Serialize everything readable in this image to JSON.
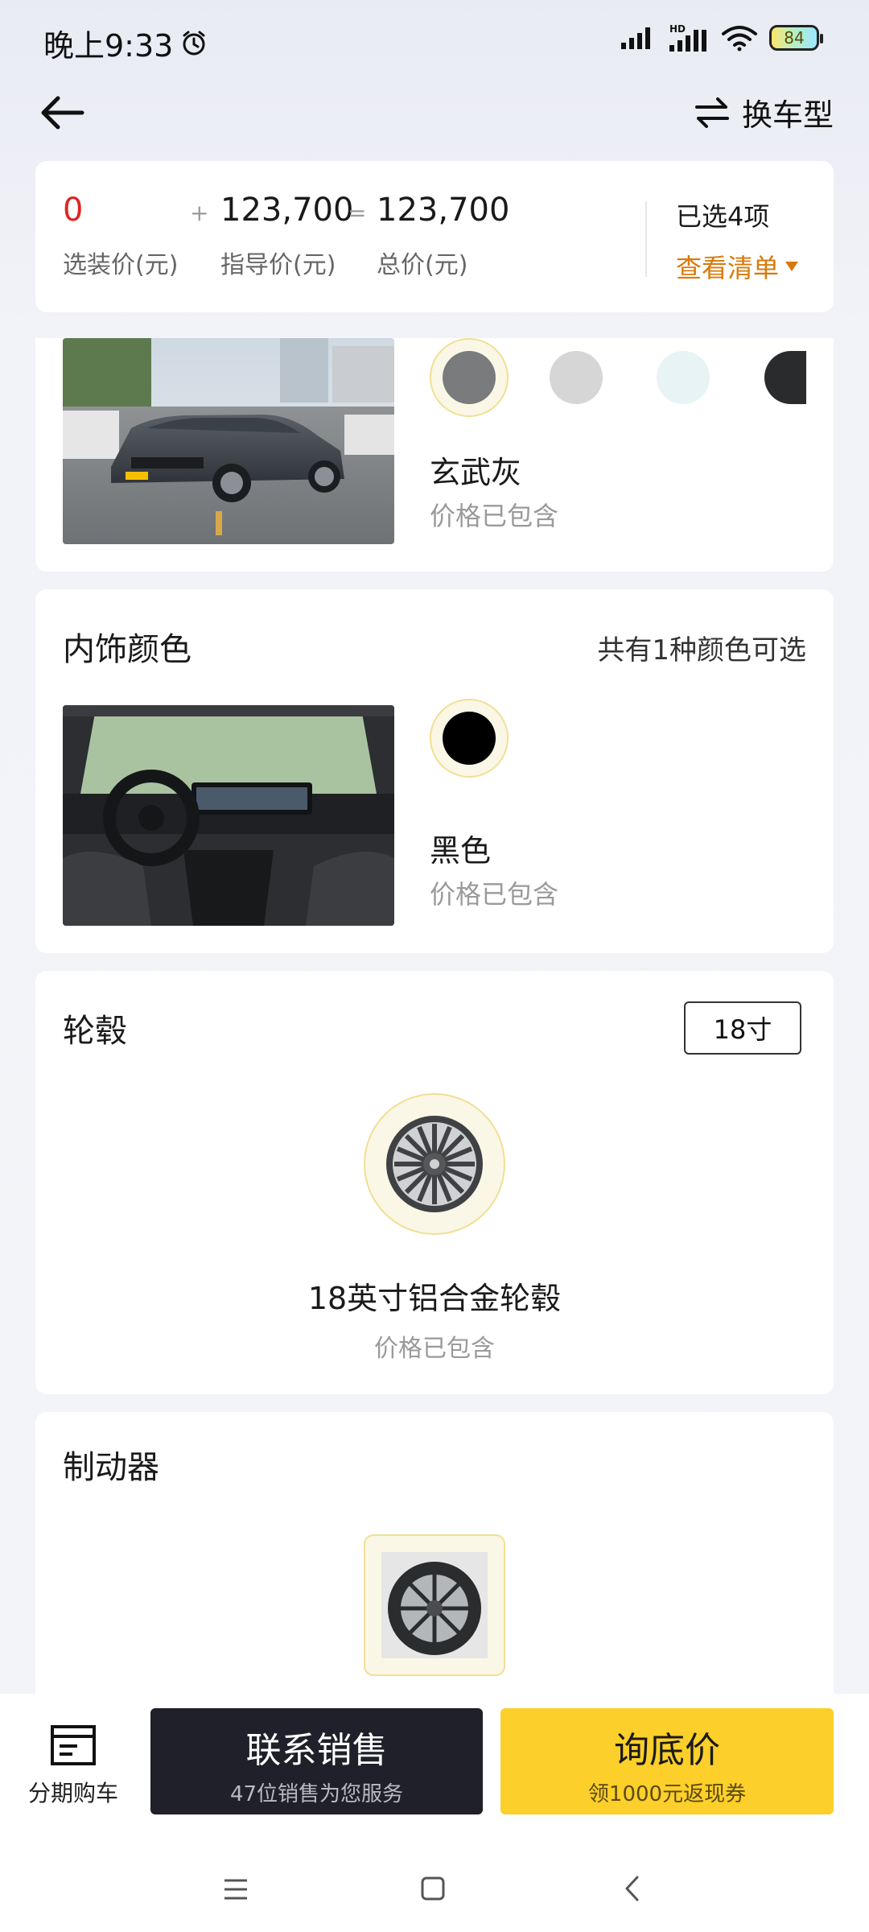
{
  "status_bar": {
    "time": "晚上9:33",
    "battery_level": "84",
    "icons": [
      "alarm-icon",
      "signal-icon",
      "hd-signal-icon",
      "wifi-icon",
      "battery-icon"
    ]
  },
  "nav": {
    "back_icon": "back-arrow-icon",
    "switch_icon": "swap-icon",
    "switch_label": "换车型"
  },
  "price_summary": {
    "option_price": "0",
    "option_price_label": "选装价(元)",
    "plus_sign": "+",
    "guide_price": "123,700",
    "guide_price_label": "指导价(元)",
    "equals_sign": "=",
    "total_price": "123,700",
    "total_price_label": "总价(元)",
    "selected_count": "已选4项",
    "view_list": "查看清单",
    "accent_color": "#d9790b",
    "option_price_color": "#e02424"
  },
  "exterior": {
    "swatches": [
      "#7a7b7d",
      "#d6d6d6",
      "#e8f3f5",
      "#2a2b2d"
    ],
    "selected_index": 0,
    "color_name": "玄武灰",
    "price_note": "价格已包含"
  },
  "interior": {
    "title": "内饰颜色",
    "count_text": "共有1种颜色可选",
    "swatch": "#000000",
    "color_name": "黑色",
    "price_note": "价格已包含"
  },
  "wheels": {
    "title": "轮毂",
    "size_button": "18寸",
    "name": "18英寸铝合金轮毂",
    "price_note": "价格已包含"
  },
  "brakes": {
    "title": "制动器"
  },
  "bottom_bar": {
    "installment_icon": "installment-icon",
    "installment_label": "分期购车",
    "contact_label": "联系销售",
    "contact_sub": "47位销售为您服务",
    "inquiry_label": "询底价",
    "inquiry_sub": "领1000元返现券",
    "inquiry_color": "#fccf2a"
  },
  "system_nav": {
    "icons": [
      "menu-icon",
      "home-icon",
      "back-icon"
    ]
  }
}
